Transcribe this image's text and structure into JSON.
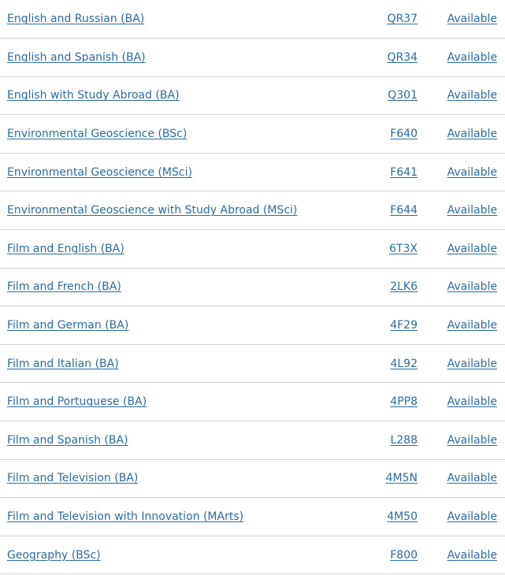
{
  "courses": [
    {
      "name": "English and Russian (BA)",
      "code": "QR37",
      "status": "Available"
    },
    {
      "name": "English and Spanish (BA)",
      "code": "QR34",
      "status": "Available"
    },
    {
      "name": "English with Study Abroad (BA)",
      "code": "Q301",
      "status": "Available"
    },
    {
      "name": "Environmental Geoscience (BSc)",
      "code": "F640",
      "status": "Available"
    },
    {
      "name": "Environmental Geoscience (MSci)",
      "code": "F641",
      "status": "Available"
    },
    {
      "name": "Environmental Geoscience with Study Abroad (MSci)",
      "code": "F644",
      "status": "Available"
    },
    {
      "name": "Film and English (BA)",
      "code": "6T3X",
      "status": "Available"
    },
    {
      "name": "Film and French (BA)",
      "code": "2LK6",
      "status": "Available"
    },
    {
      "name": "Film and German (BA)",
      "code": "4F29",
      "status": "Available"
    },
    {
      "name": "Film and Italian (BA)",
      "code": "4L92",
      "status": "Available"
    },
    {
      "name": "Film and Portuguese (BA)",
      "code": "4PP8",
      "status": "Available"
    },
    {
      "name": "Film and Spanish (BA)",
      "code": "L288",
      "status": "Available"
    },
    {
      "name": "Film and Television (BA)",
      "code": "4M5N",
      "status": "Available"
    },
    {
      "name": "Film and Television with Innovation (MArts)",
      "code": "4M50",
      "status": "Available"
    },
    {
      "name": "Geography (BSc)",
      "code": "F800",
      "status": "Available"
    }
  ],
  "colors": {
    "link": "#2a6ca3",
    "divider": "#d4d4d4"
  }
}
